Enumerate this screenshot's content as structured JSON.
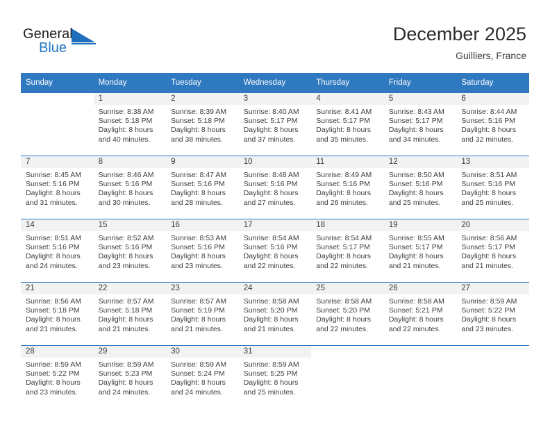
{
  "brand": {
    "name_dark": "General",
    "name_blue": "Blue",
    "logo_icon": "triangle-logo-icon",
    "accent_color": "#1f6fbd"
  },
  "header": {
    "month_title": "December 2025",
    "location": "Guilliers, France"
  },
  "theme": {
    "header_bg": "#2f79c0",
    "daynum_bg": "#f2f2f2",
    "cell_bg": "#ffffff",
    "text_color": "#3c3c3c"
  },
  "calendar": {
    "weekday_headers": [
      "Sunday",
      "Monday",
      "Tuesday",
      "Wednesday",
      "Thursday",
      "Friday",
      "Saturday"
    ],
    "weeks": [
      [
        {
          "day": "",
          "lines": []
        },
        {
          "day": "1",
          "lines": [
            "Sunrise: 8:38 AM",
            "Sunset: 5:18 PM",
            "Daylight: 8 hours",
            "and 40 minutes."
          ]
        },
        {
          "day": "2",
          "lines": [
            "Sunrise: 8:39 AM",
            "Sunset: 5:18 PM",
            "Daylight: 8 hours",
            "and 38 minutes."
          ]
        },
        {
          "day": "3",
          "lines": [
            "Sunrise: 8:40 AM",
            "Sunset: 5:17 PM",
            "Daylight: 8 hours",
            "and 37 minutes."
          ]
        },
        {
          "day": "4",
          "lines": [
            "Sunrise: 8:41 AM",
            "Sunset: 5:17 PM",
            "Daylight: 8 hours",
            "and 35 minutes."
          ]
        },
        {
          "day": "5",
          "lines": [
            "Sunrise: 8:43 AM",
            "Sunset: 5:17 PM",
            "Daylight: 8 hours",
            "and 34 minutes."
          ]
        },
        {
          "day": "6",
          "lines": [
            "Sunrise: 8:44 AM",
            "Sunset: 5:16 PM",
            "Daylight: 8 hours",
            "and 32 minutes."
          ]
        }
      ],
      [
        {
          "day": "7",
          "lines": [
            "Sunrise: 8:45 AM",
            "Sunset: 5:16 PM",
            "Daylight: 8 hours",
            "and 31 minutes."
          ]
        },
        {
          "day": "8",
          "lines": [
            "Sunrise: 8:46 AM",
            "Sunset: 5:16 PM",
            "Daylight: 8 hours",
            "and 30 minutes."
          ]
        },
        {
          "day": "9",
          "lines": [
            "Sunrise: 8:47 AM",
            "Sunset: 5:16 PM",
            "Daylight: 8 hours",
            "and 28 minutes."
          ]
        },
        {
          "day": "10",
          "lines": [
            "Sunrise: 8:48 AM",
            "Sunset: 5:16 PM",
            "Daylight: 8 hours",
            "and 27 minutes."
          ]
        },
        {
          "day": "11",
          "lines": [
            "Sunrise: 8:49 AM",
            "Sunset: 5:16 PM",
            "Daylight: 8 hours",
            "and 26 minutes."
          ]
        },
        {
          "day": "12",
          "lines": [
            "Sunrise: 8:50 AM",
            "Sunset: 5:16 PM",
            "Daylight: 8 hours",
            "and 25 minutes."
          ]
        },
        {
          "day": "13",
          "lines": [
            "Sunrise: 8:51 AM",
            "Sunset: 5:16 PM",
            "Daylight: 8 hours",
            "and 25 minutes."
          ]
        }
      ],
      [
        {
          "day": "14",
          "lines": [
            "Sunrise: 8:51 AM",
            "Sunset: 5:16 PM",
            "Daylight: 8 hours",
            "and 24 minutes."
          ]
        },
        {
          "day": "15",
          "lines": [
            "Sunrise: 8:52 AM",
            "Sunset: 5:16 PM",
            "Daylight: 8 hours",
            "and 23 minutes."
          ]
        },
        {
          "day": "16",
          "lines": [
            "Sunrise: 8:53 AM",
            "Sunset: 5:16 PM",
            "Daylight: 8 hours",
            "and 23 minutes."
          ]
        },
        {
          "day": "17",
          "lines": [
            "Sunrise: 8:54 AM",
            "Sunset: 5:16 PM",
            "Daylight: 8 hours",
            "and 22 minutes."
          ]
        },
        {
          "day": "18",
          "lines": [
            "Sunrise: 8:54 AM",
            "Sunset: 5:17 PM",
            "Daylight: 8 hours",
            "and 22 minutes."
          ]
        },
        {
          "day": "19",
          "lines": [
            "Sunrise: 8:55 AM",
            "Sunset: 5:17 PM",
            "Daylight: 8 hours",
            "and 21 minutes."
          ]
        },
        {
          "day": "20",
          "lines": [
            "Sunrise: 8:56 AM",
            "Sunset: 5:17 PM",
            "Daylight: 8 hours",
            "and 21 minutes."
          ]
        }
      ],
      [
        {
          "day": "21",
          "lines": [
            "Sunrise: 8:56 AM",
            "Sunset: 5:18 PM",
            "Daylight: 8 hours",
            "and 21 minutes."
          ]
        },
        {
          "day": "22",
          "lines": [
            "Sunrise: 8:57 AM",
            "Sunset: 5:18 PM",
            "Daylight: 8 hours",
            "and 21 minutes."
          ]
        },
        {
          "day": "23",
          "lines": [
            "Sunrise: 8:57 AM",
            "Sunset: 5:19 PM",
            "Daylight: 8 hours",
            "and 21 minutes."
          ]
        },
        {
          "day": "24",
          "lines": [
            "Sunrise: 8:58 AM",
            "Sunset: 5:20 PM",
            "Daylight: 8 hours",
            "and 21 minutes."
          ]
        },
        {
          "day": "25",
          "lines": [
            "Sunrise: 8:58 AM",
            "Sunset: 5:20 PM",
            "Daylight: 8 hours",
            "and 22 minutes."
          ]
        },
        {
          "day": "26",
          "lines": [
            "Sunrise: 8:58 AM",
            "Sunset: 5:21 PM",
            "Daylight: 8 hours",
            "and 22 minutes."
          ]
        },
        {
          "day": "27",
          "lines": [
            "Sunrise: 8:59 AM",
            "Sunset: 5:22 PM",
            "Daylight: 8 hours",
            "and 23 minutes."
          ]
        }
      ],
      [
        {
          "day": "28",
          "lines": [
            "Sunrise: 8:59 AM",
            "Sunset: 5:22 PM",
            "Daylight: 8 hours",
            "and 23 minutes."
          ]
        },
        {
          "day": "29",
          "lines": [
            "Sunrise: 8:59 AM",
            "Sunset: 5:23 PM",
            "Daylight: 8 hours",
            "and 24 minutes."
          ]
        },
        {
          "day": "30",
          "lines": [
            "Sunrise: 8:59 AM",
            "Sunset: 5:24 PM",
            "Daylight: 8 hours",
            "and 24 minutes."
          ]
        },
        {
          "day": "31",
          "lines": [
            "Sunrise: 8:59 AM",
            "Sunset: 5:25 PM",
            "Daylight: 8 hours",
            "and 25 minutes."
          ]
        },
        {
          "day": "",
          "lines": []
        },
        {
          "day": "",
          "lines": []
        },
        {
          "day": "",
          "lines": []
        }
      ]
    ]
  }
}
